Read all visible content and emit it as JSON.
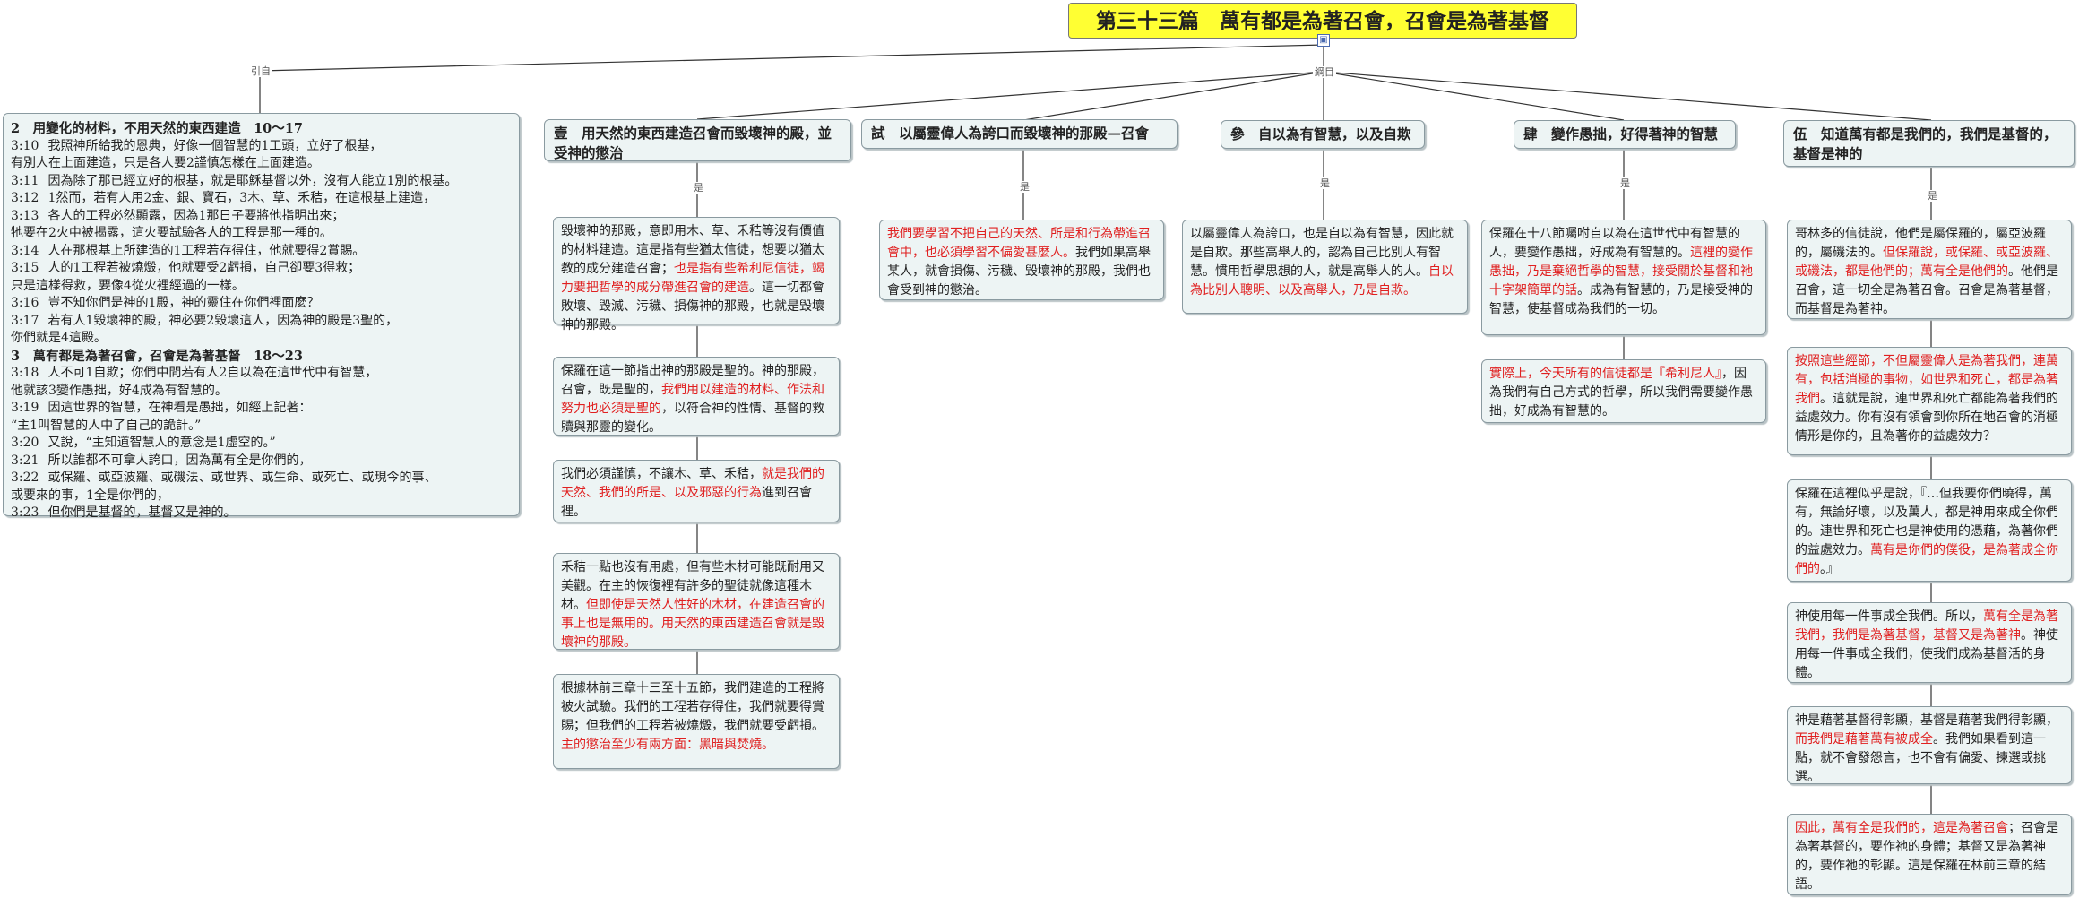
{
  "title": "第三十三篇　萬有都是為著召會，召會是為著基督",
  "root_icon": "▣",
  "connectors": {
    "intro": "引自",
    "outline": "綱目",
    "is": "是"
  },
  "scripture": {
    "heading1": "2　用變化的材料，不用天然的東西建造　10～17",
    "verses1": [
      {
        "ref": "3:10",
        "text": "我照神所給我的恩典，好像一個智慧的1工頭，立好了根基，"
      },
      {
        "ref": "",
        "text": "有別人在上面建造，只是各人要2謹慎怎樣在上面建造。"
      },
      {
        "ref": "3:11",
        "text": "因為除了那已經立好的根基，就是耶穌基督以外，沒有人能立1別的根基。"
      },
      {
        "ref": "3:12",
        "text": "1然而，若有人用2金、銀、寶石，3木、草、禾秸，在這根基上建造，"
      },
      {
        "ref": "3:13",
        "text": "各人的工程必然顯露，因為1那日子要將他指明出來；"
      },
      {
        "ref": "",
        "text": "牠要在2火中被揭露，這火要試驗各人的工程是那一種的。"
      },
      {
        "ref": "3:14",
        "text": "人在那根基上所建造的1工程若存得住，他就要得2賞賜。"
      },
      {
        "ref": "3:15",
        "text": "人的1工程若被燒燬，他就要受2虧損，自己卻要3得救；"
      },
      {
        "ref": "",
        "text": "只是這樣得救，要像4從火裡經過的一樣。"
      },
      {
        "ref": "3:16",
        "text": "豈不知你們是神的1殿，神的靈住在你們裡面麼？"
      },
      {
        "ref": "3:17",
        "text": "若有人1毀壞神的殿，神必要2毀壞這人，因為神的殿是3聖的，"
      },
      {
        "ref": "",
        "text": "你們就是4這殿。"
      }
    ],
    "heading2": "3　萬有都是為著召會，召會是為著基督　18～23",
    "verses2": [
      {
        "ref": "3:18",
        "text": "人不可1自欺；你們中間若有人2自以為在這世代中有智慧，"
      },
      {
        "ref": "",
        "text": "他就該3變作愚拙，好4成為有智慧的。"
      },
      {
        "ref": "3:19",
        "text": "因這世界的智慧，在神看是愚拙，如經上記著："
      },
      {
        "ref": "",
        "text": "“主1叫智慧的人中了自己的詭計。”"
      },
      {
        "ref": "3:20",
        "text": "又說，“主知道智慧人的意念是1虛空的。”"
      },
      {
        "ref": "3:21",
        "text": "所以誰都不可拿人誇口，因為萬有全是你們的，"
      },
      {
        "ref": "3:22",
        "text": "或保羅、或亞波羅、或磯法、或世界、或生命、或死亡、或現今的事、"
      },
      {
        "ref": "",
        "text": "或要來的事，1全是你們的，"
      },
      {
        "ref": "3:23",
        "text": "但你們是基督的，基督又是神的。"
      }
    ]
  },
  "sections": [
    {
      "title": "壹　用天然的東西建造召會而毀壞神的殿，並受神的懲治",
      "notes": [
        [
          {
            "t": "毀壞神的那殿，意即用木、草、禾秸等沒有價值的材料建造。這是指有些猶太信徒，想要以猶太教的成分建造召會；"
          },
          {
            "t": "也是指有些希利尼信徒，竭力要把哲學的成分帶進召會的建造",
            "r": true
          },
          {
            "t": "。這一切都會敗壞、毀滅、污穢、損傷神的那殿，也就是毀壞神的那殿。"
          }
        ],
        [
          {
            "t": "保羅在這一節指出神的那殿是聖的。神的那殿，召會，既是聖的，"
          },
          {
            "t": "我們用以建造的材料、作法和努力也必須是聖的",
            "r": true
          },
          {
            "t": "，以符合神的性情、基督的救贖與那靈的變化。"
          }
        ],
        [
          {
            "t": "我們必須謹慎，不讓木、草、禾秸，"
          },
          {
            "t": "就是我們的天然、我們的所是、以及邪惡的行為",
            "r": true
          },
          {
            "t": "進到召會裡。"
          }
        ],
        [
          {
            "t": "禾秸一點也沒有用處，但有些木材可能既耐用又美觀。在主的恢復裡有許多的聖徒就像這種木材。"
          },
          {
            "t": "但即使是天然人性好的木材，在建造召會的事上也是無用的。用天然的東西建造召會就是毀壞神的那殿。",
            "r": true
          }
        ],
        [
          {
            "t": "根據林前三章十三至十五節，我們建造的工程將被火試驗。我們的工程若存得住，我們就要得賞賜；但我們的工程若被燒燬，我們就要受虧損。"
          },
          {
            "t": "主的懲治至少有兩方面：黑暗與焚燒。",
            "r": true
          }
        ]
      ]
    },
    {
      "title": "試　以屬靈偉人為誇口而毀壞神的那殿—召會",
      "notes": [
        [
          {
            "t": "我們要學習不把自己的天然、所是和行為帶進召會中，也必須學習不偏愛甚麼人。",
            "r": true
          },
          {
            "t": "我們如果高舉某人，就會損傷、污穢、毀壞神的那殿，我們也會受到神的懲治。"
          }
        ]
      ]
    },
    {
      "title": "參　自以為有智慧，以及自欺",
      "notes": [
        [
          {
            "t": "以屬靈偉人為誇口，也是自以為有智慧，因此就是自欺。那些高舉人的，認為自己比別人有智慧。慣用哲學思想的人，就是高舉人的人。"
          },
          {
            "t": "自以為比別人聰明、以及高舉人，乃是自欺。",
            "r": true
          }
        ]
      ]
    },
    {
      "title": "肆　變作愚拙，好得著神的智慧",
      "notes": [
        [
          {
            "t": "保羅在十八節囑咐自以為在這世代中有智慧的人，要變作愚拙，好成為有智慧的。"
          },
          {
            "t": "這裡的變作愚拙，乃是棄絕哲學的智慧，接受關於基督和祂十字架簡單的話",
            "r": true
          },
          {
            "t": "。成為有智慧的，乃是接受神的智慧，使基督成為我們的一切。"
          }
        ],
        [
          {
            "t": "實際上，今天所有的信徒都是『希利尼人』",
            "r": true
          },
          {
            "t": "，因為我們有自己方式的哲學，所以我們需要變作愚拙，好成為有智慧的。"
          }
        ]
      ]
    },
    {
      "title": "伍　知道萬有都是我們的，我們是基督的，基督是神的",
      "notes": [
        [
          {
            "t": "哥林多的信徒說，他們是屬保羅的，屬亞波羅的，屬磯法的。"
          },
          {
            "t": "但保羅說，或保羅、或亞波羅、或磯法，都是他們的；萬有全是他們的",
            "r": true
          },
          {
            "t": "。他們是召會，這一切全是為著召會。召會是為著基督，而基督是為著神。"
          }
        ],
        [
          {
            "t": "按照這些經節，不但屬靈偉人是為著我們，連萬有，包括消極的事物，如世界和死亡，都是為著我們",
            "r": true
          },
          {
            "t": "。這就是說，連世界和死亡都能為著我們的益處效力。你有沒有領會到你所在地召會的消極情形是你的，且為著你的益處效力？"
          }
        ],
        [
          {
            "t": "保羅在這裡似乎是說，『…但我要你們曉得，萬有，無論好壞，以及萬人，都是神用來成全你們的。連世界和死亡也是神使用的憑藉，為著你們的益處效力。"
          },
          {
            "t": "萬有是你們的僕役，是為著成全你們的",
            "r": true
          },
          {
            "t": "。』"
          }
        ],
        [
          {
            "t": "神使用每一件事成全我們。所以，"
          },
          {
            "t": "萬有全是為著我們，我們是為著基督，基督又是為著神",
            "r": true
          },
          {
            "t": "。神使用每一件事成全我們，使我們成為基督活的身體。"
          }
        ],
        [
          {
            "t": "神是藉著基督得彰顯，基督是藉著我們得彰顯，"
          },
          {
            "t": "而我們是藉著萬有被成全",
            "r": true
          },
          {
            "t": "。我們如果看到這一點，就不會發怨言，也不會有偏愛、揀選或挑選。"
          }
        ],
        [
          {
            "t": "因此，萬有全是我們的，這是為著召會",
            "r": true
          },
          {
            "t": "；召會是為著基督的，要作祂的身體；基督又是為著神的，要作祂的彰顯。這是保羅在林前三章的結語。"
          }
        ]
      ]
    }
  ]
}
